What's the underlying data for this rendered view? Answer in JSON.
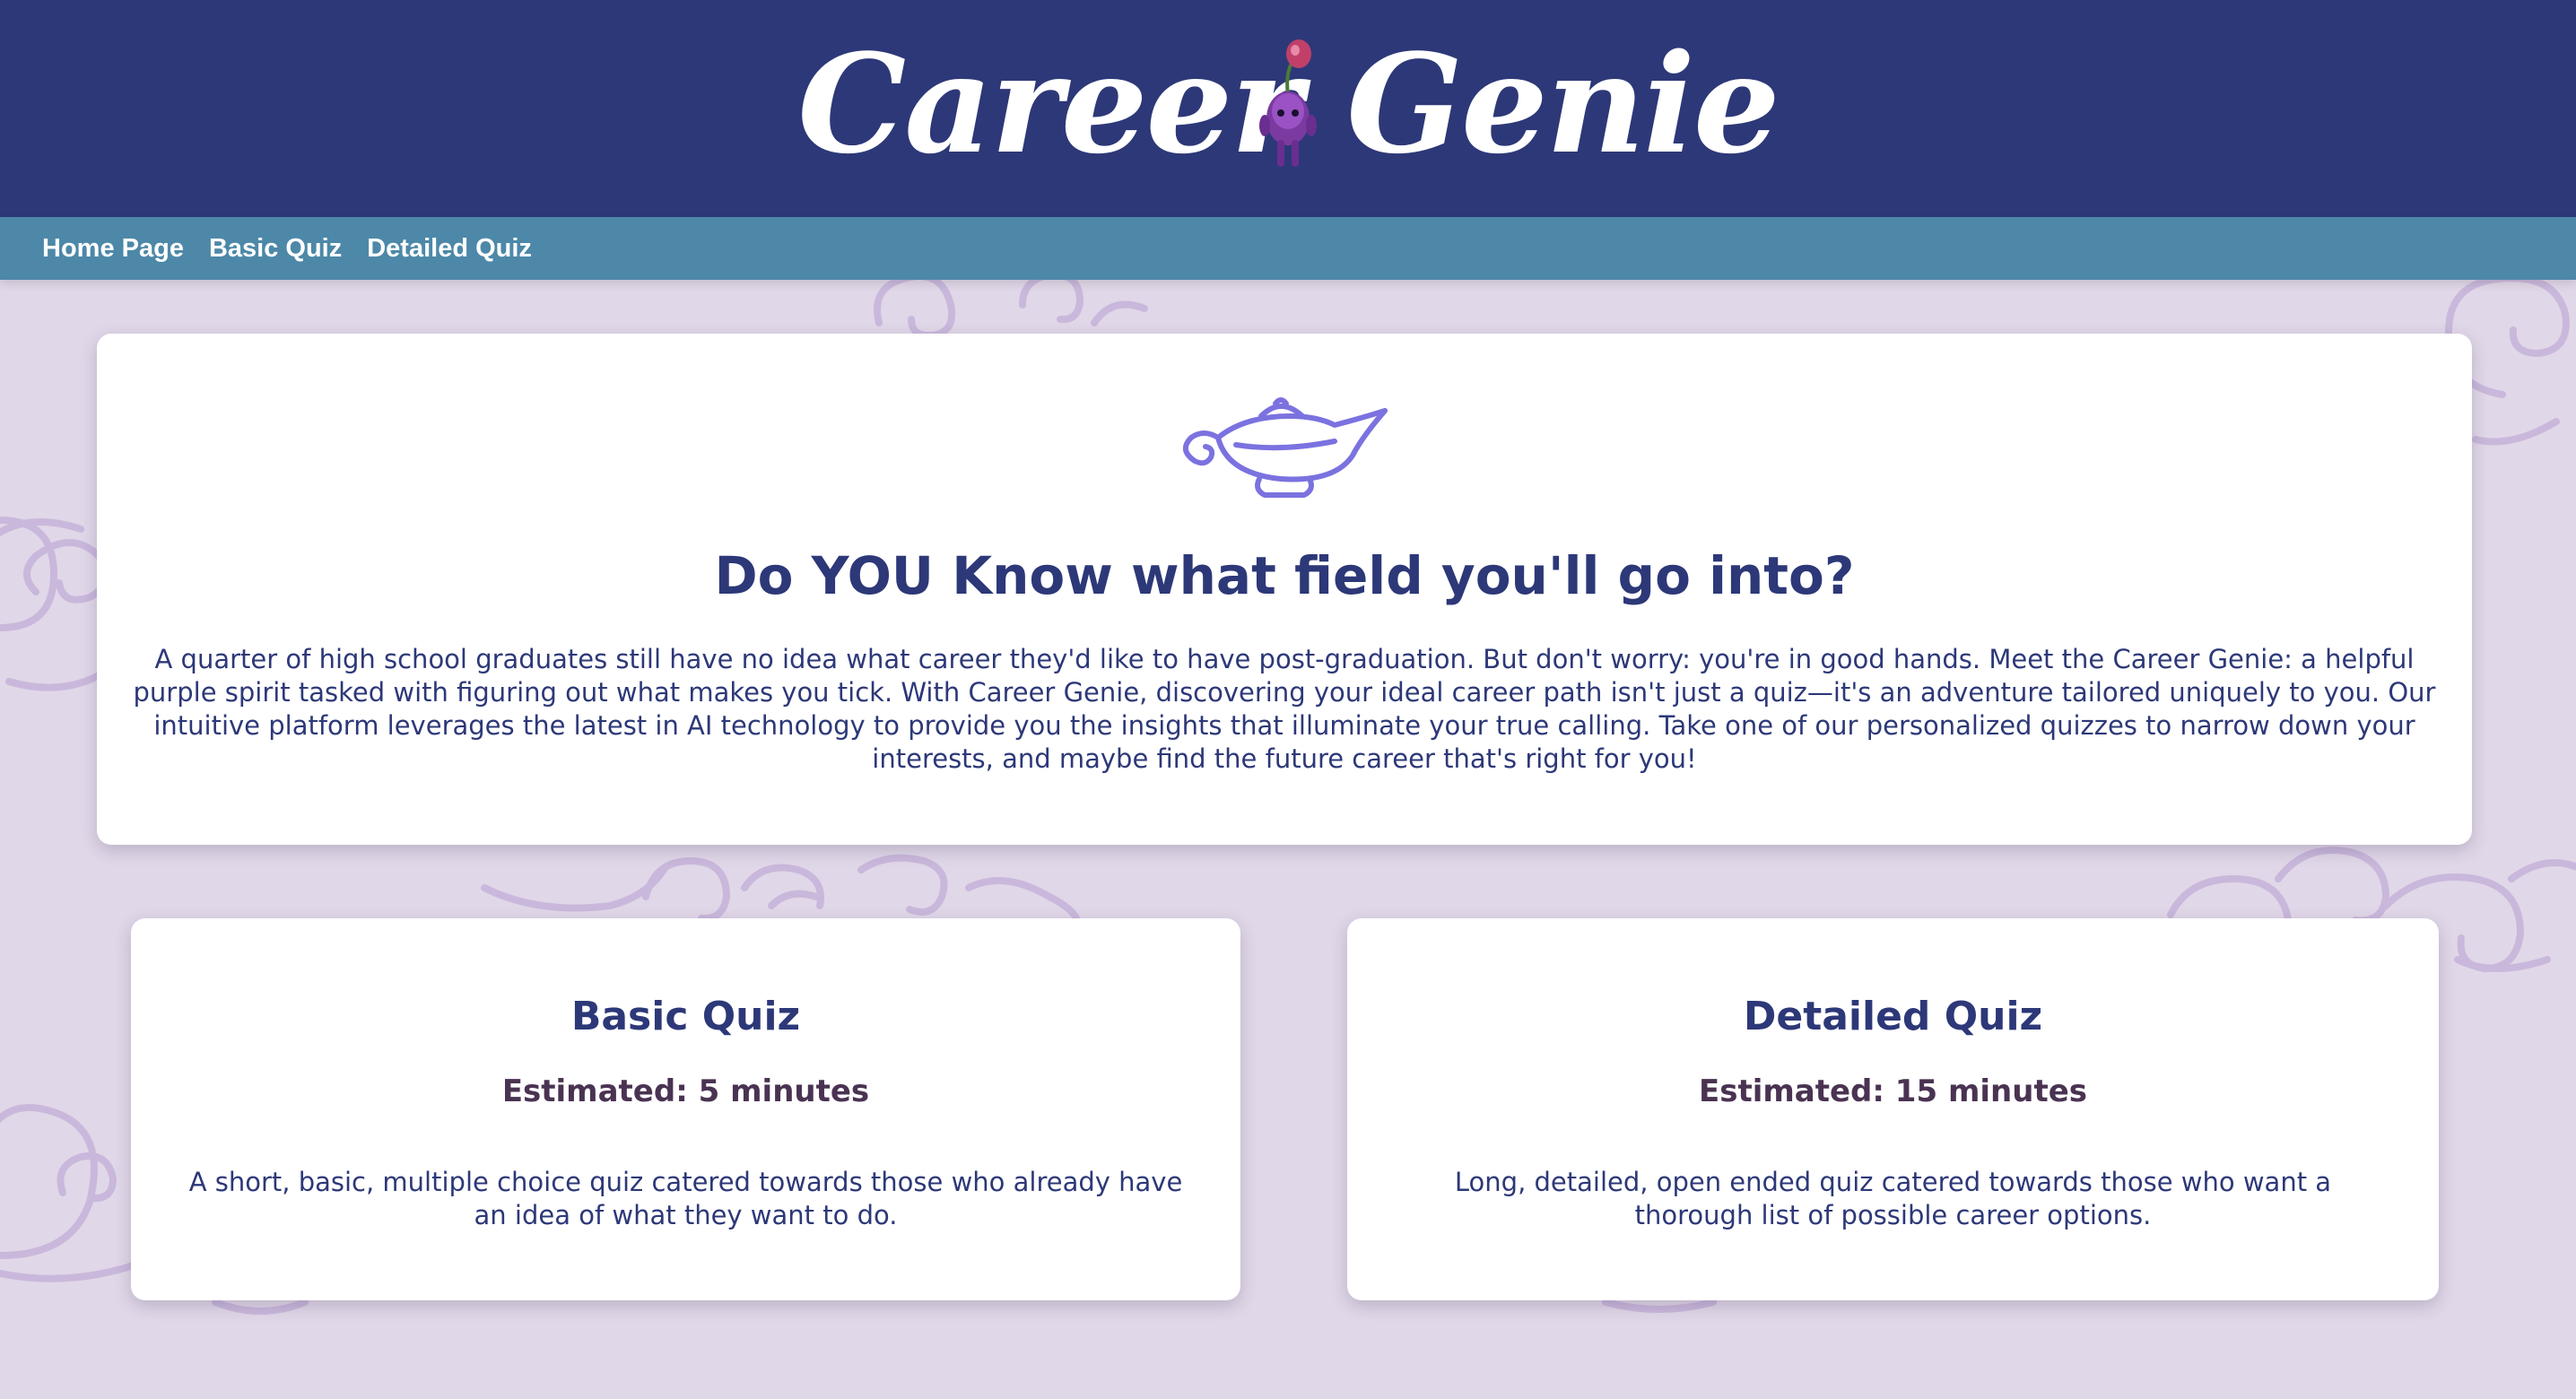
{
  "header": {
    "logo_text": "Career Genie"
  },
  "nav": {
    "items": [
      {
        "label": "Home Page"
      },
      {
        "label": "Basic Quiz"
      },
      {
        "label": "Detailed Quiz"
      }
    ]
  },
  "hero": {
    "icon": "genie-lamp-icon",
    "title": "Do YOU Know what field you'll go into?",
    "body": "A quarter of high school graduates still have no idea what career they'd like to have post-graduation. But don't worry: you're in good hands. Meet the Career Genie: a helpful purple spirit tasked with figuring out what makes you tick. With Career Genie, discovering your ideal career path isn't just a quiz—it's an adventure tailored uniquely to you. Our intuitive platform leverages the latest in AI technology to provide you the insights that illuminate your true calling. Take one of our personalized quizzes to narrow down your interests, and maybe find the future career that's right for you!"
  },
  "quizzes": {
    "basic": {
      "title": "Basic Quiz",
      "time": "Estimated: 5 minutes",
      "description": "A short, basic, multiple choice quiz catered towards those who already have an idea of what they want to do."
    },
    "detailed": {
      "title": "Detailed Quiz",
      "time": "Estimated: 15 minutes",
      "description": "Long, detailed, open ended quiz catered towards those who want a thorough list of possible career options."
    }
  },
  "colors": {
    "header_bg": "#2d3878",
    "nav_bg": "#4d88a8",
    "page_bg": "#e0d7e8",
    "accent_purple": "#7b72e0",
    "heading_text": "#2d3878"
  }
}
